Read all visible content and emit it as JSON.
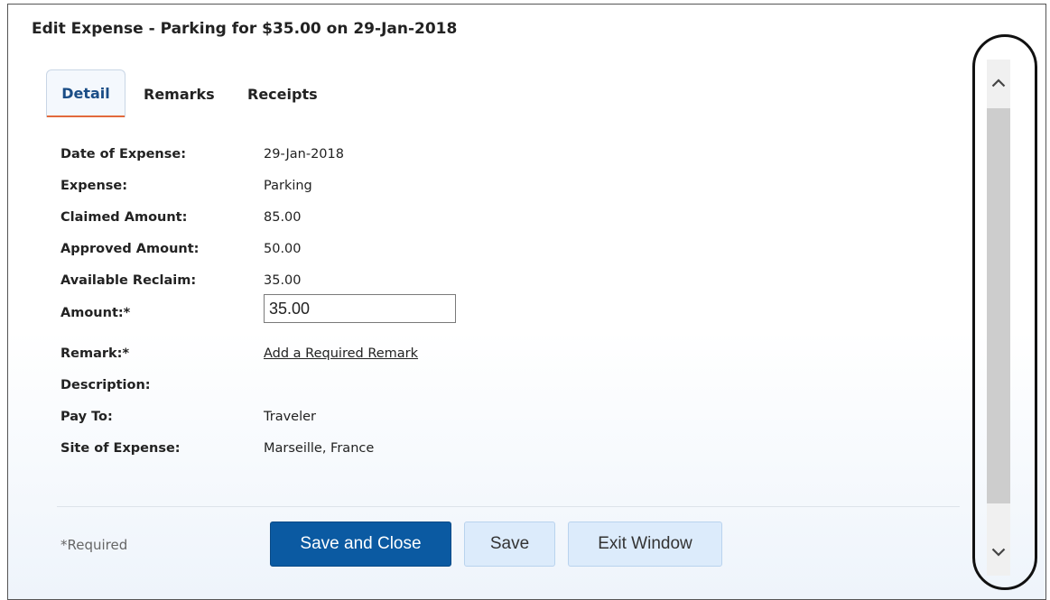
{
  "dialog": {
    "title": "Edit Expense - Parking for $35.00 on 29-Jan-2018"
  },
  "tabs": [
    {
      "label": "Detail",
      "active": true
    },
    {
      "label": "Remarks",
      "active": false
    },
    {
      "label": "Receipts",
      "active": false
    }
  ],
  "fields": {
    "date_of_expense": {
      "label": "Date of Expense:",
      "value": "29-Jan-2018"
    },
    "expense": {
      "label": "Expense:",
      "value": "Parking"
    },
    "claimed_amount": {
      "label": "Claimed Amount:",
      "value": "85.00"
    },
    "approved_amount": {
      "label": "Approved Amount:",
      "value": "50.00"
    },
    "available_reclaim": {
      "label": "Available Reclaim:",
      "value": "35.00"
    },
    "amount": {
      "label": "Amount:*",
      "value": "35.00"
    },
    "remark": {
      "label": "Remark:*",
      "link_text": "Add a Required Remark"
    },
    "description": {
      "label": "Description:",
      "value": ""
    },
    "pay_to": {
      "label": "Pay To:",
      "value": "Traveler"
    },
    "site_of_expense": {
      "label": "Site of Expense:",
      "value": "Marseille, France"
    }
  },
  "footer": {
    "required_note": "*Required",
    "save_and_close_label": "Save and Close",
    "save_label": "Save",
    "exit_window_label": "Exit Window"
  },
  "colors": {
    "primary_button": "#0b5aa2",
    "secondary_button": "#dcebfb",
    "active_tab_underline": "#e2693c",
    "link": "#1a5ea8"
  },
  "icons": {
    "scroll_up": "chevron-up-icon",
    "scroll_down": "chevron-down-icon"
  }
}
